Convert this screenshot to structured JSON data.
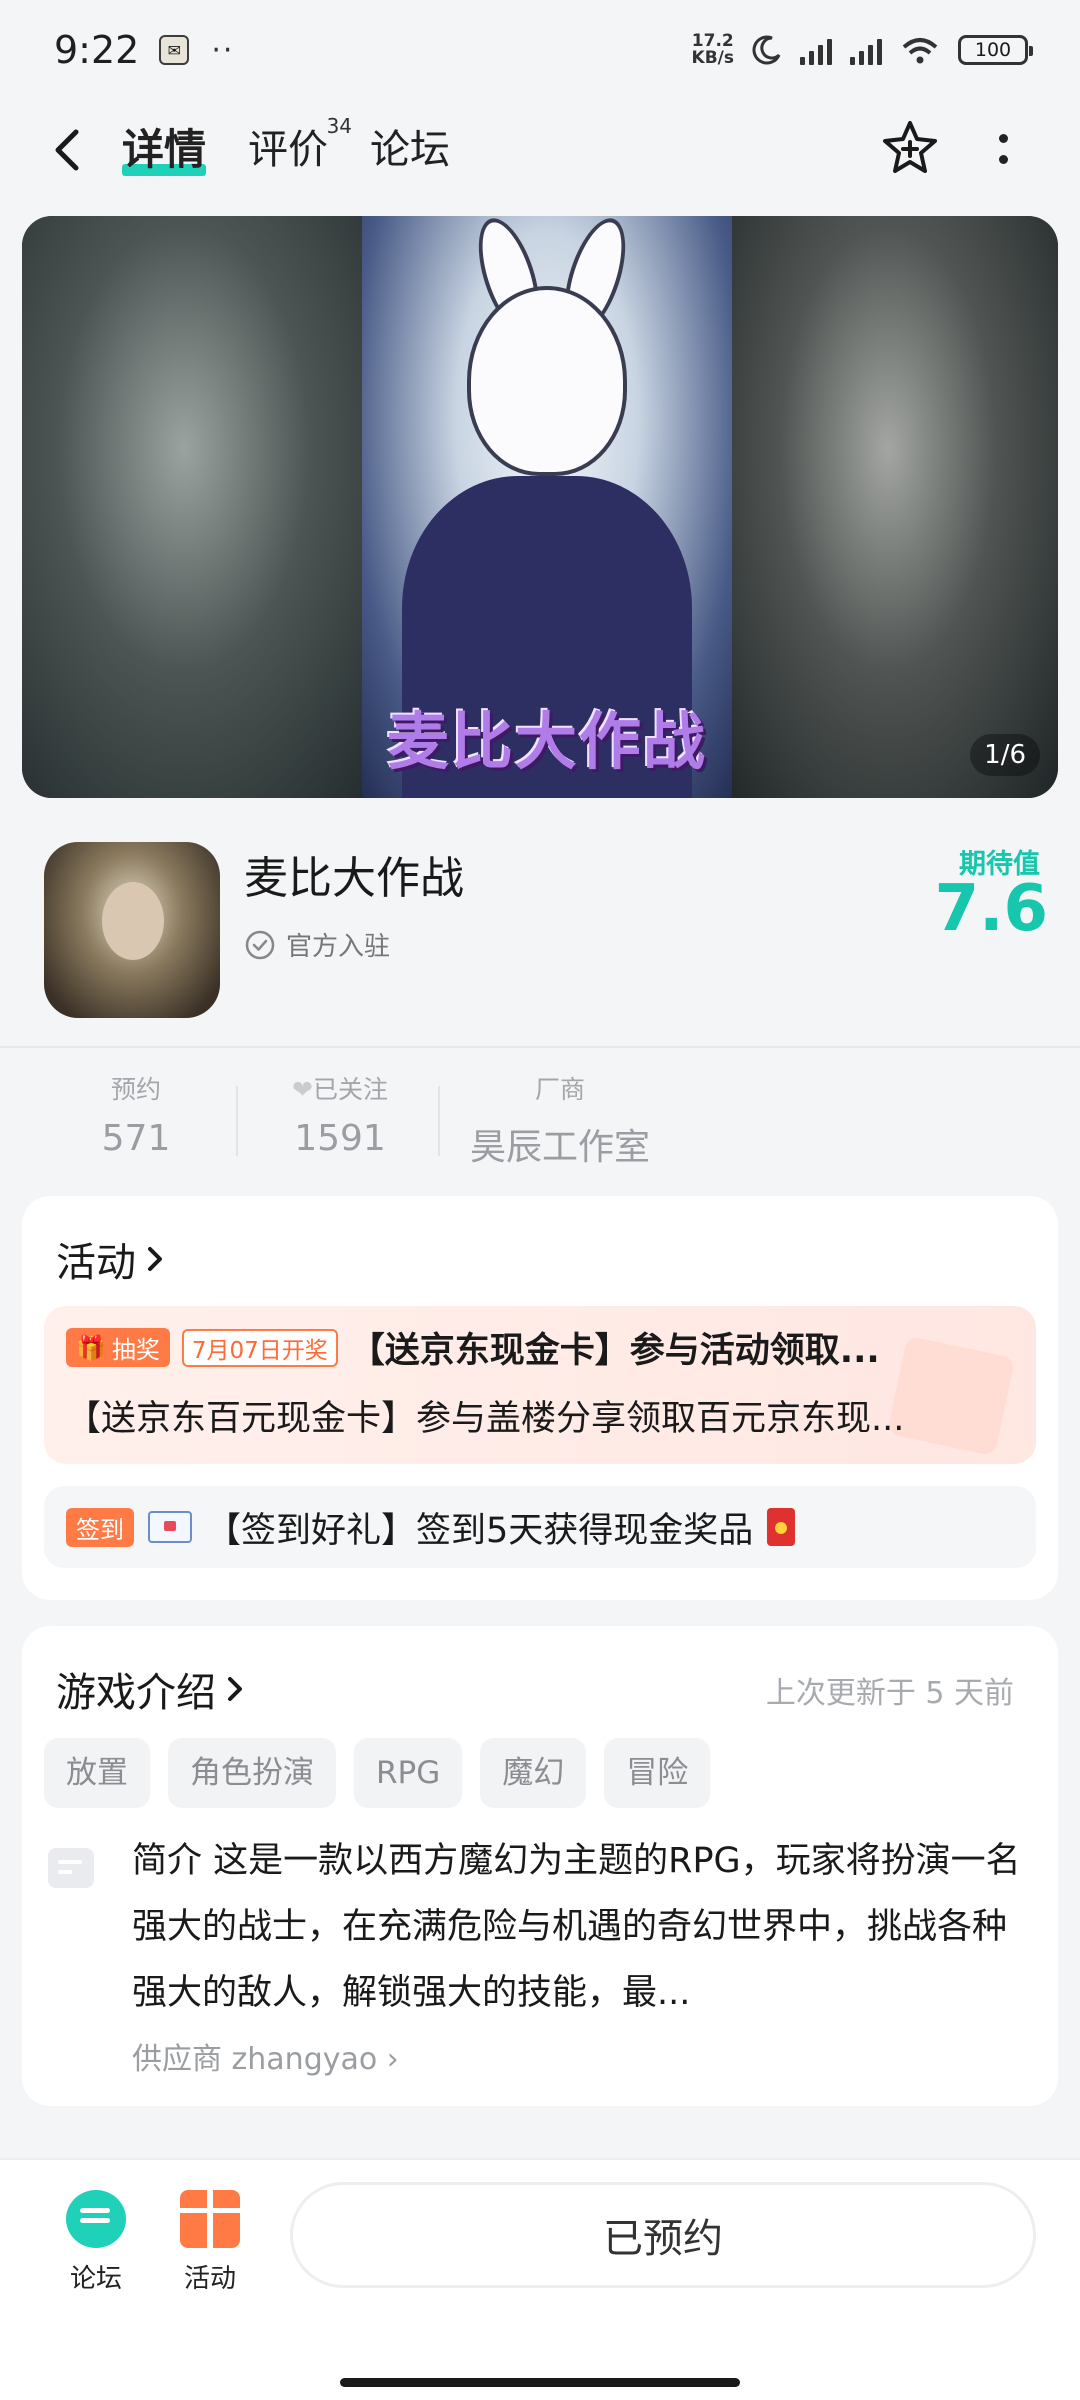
{
  "status": {
    "time": "9:22",
    "speed_value": "17.2",
    "speed_unit": "KB/s",
    "battery": "100"
  },
  "nav": {
    "tabs": [
      {
        "label": "详情"
      },
      {
        "label": "评价",
        "count": "34"
      },
      {
        "label": "论坛"
      }
    ]
  },
  "banner": {
    "logo_title": "麦比大作战",
    "counter": "1/6"
  },
  "game": {
    "name": "麦比大作战",
    "official_label": "官方入驻",
    "expect_label": "期待值",
    "expect_value": "7.6"
  },
  "stats": [
    {
      "label": "预约",
      "value": "571"
    },
    {
      "label": "已关注",
      "value": "1591"
    },
    {
      "label": "厂商",
      "value": "昊辰工作室"
    }
  ],
  "activity": {
    "title": "活动",
    "lottery": {
      "badge": "抽奖",
      "date_badge": "7月07日开奖",
      "headline": "【送京东现金卡】参与活动领取...",
      "subline": "【送京东百元现金卡】参与盖楼分享领取百元京东现..."
    },
    "signin": {
      "badge": "签到",
      "text": "【签到好礼】签到5天获得现金奖品"
    }
  },
  "intro": {
    "title": "游戏介绍",
    "updated": "上次更新于 5 天前",
    "tags": [
      "放置",
      "角色扮演",
      "RPG",
      "魔幻",
      "冒险"
    ],
    "text": "简介 这是一款以西方魔幻为主题的RPG，玩家将扮演一名强大的战士，在充满危险与机遇的奇幻世界中，挑战各种强大的敌人，解锁强大的技能，最...",
    "supplier": "供应商 zhangyao"
  },
  "bottom": {
    "forum_label": "论坛",
    "activity_label": "活动",
    "reserve_label": "已预约"
  },
  "colors": {
    "accent": "#1fd1b8",
    "orange": "#ff7a45",
    "background": "#f4f5f7"
  }
}
